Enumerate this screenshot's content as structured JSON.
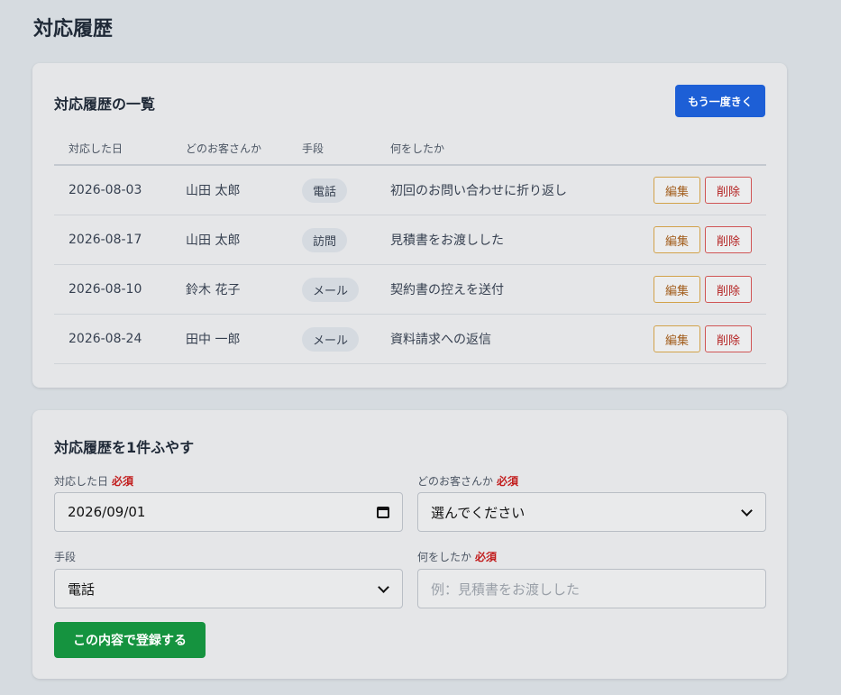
{
  "page": {
    "title": "対応履歴"
  },
  "list": {
    "title": "対応履歴の一覧",
    "reload_label": "もう一度きく",
    "columns": [
      "対応した日",
      "どのお客さんか",
      "手段",
      "何をしたか"
    ],
    "rows": [
      {
        "date": "2026-08-03",
        "customer": "山田 太郎",
        "method": "電話",
        "note": "初回のお問い合わせに折り返し"
      },
      {
        "date": "2026-08-17",
        "customer": "山田 太郎",
        "method": "訪問",
        "note": "見積書をお渡しした"
      },
      {
        "date": "2026-08-10",
        "customer": "鈴木 花子",
        "method": "メール",
        "note": "契約書の控えを送付"
      },
      {
        "date": "2026-08-24",
        "customer": "田中 一郎",
        "method": "メール",
        "note": "資料請求への返信"
      }
    ],
    "edit_label": "編集",
    "delete_label": "削除"
  },
  "form": {
    "title": "対応履歴を1件ふやす",
    "required_mark": "必須",
    "date_label": "対応した日",
    "date_value": "2026/09/01",
    "customer_label": "どのお客さんか",
    "customer_value": "選んでください",
    "method_label": "手段",
    "method_value": "電話",
    "note_label": "何をしたか",
    "note_placeholder": "例：見積書をお渡しした",
    "submit_label": "この内容で登録する"
  },
  "colors": {
    "primary": "#1d5fd6",
    "success": "#15933f",
    "required": "#c21d1d",
    "edit": "#a15c1a",
    "delete": "#b42323"
  }
}
